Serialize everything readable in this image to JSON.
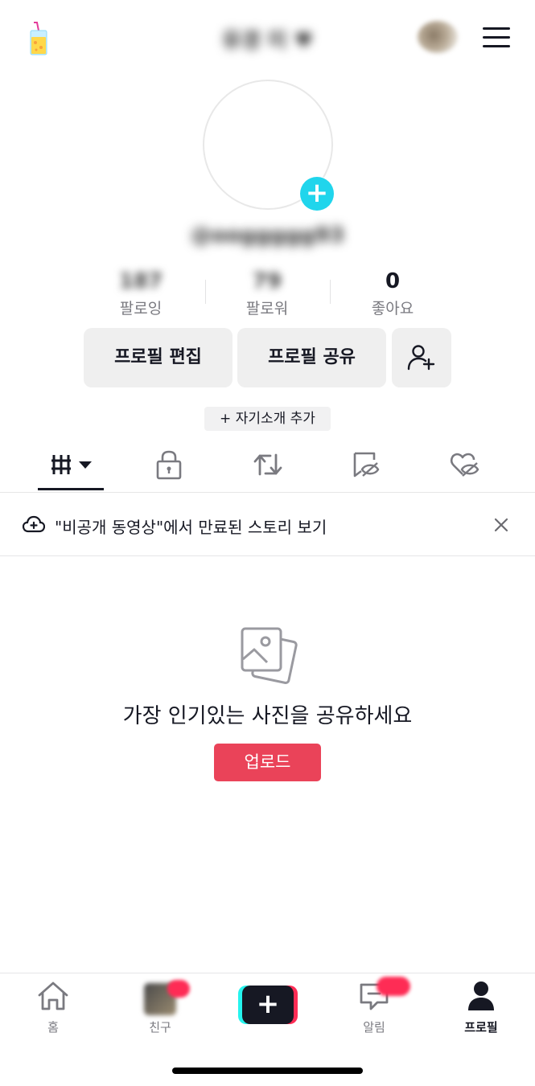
{
  "header": {
    "display_name": "유경 미 ♥",
    "menu_icon": "hamburger-menu-icon",
    "app_icon": "drink-icon"
  },
  "profile": {
    "handle": "@ooggggg93",
    "avatar_add_icon": "plus-icon"
  },
  "stats": [
    {
      "value": "187",
      "label": "팔로잉"
    },
    {
      "value": "79",
      "label": "팔로워"
    },
    {
      "value": "0",
      "label": "좋아요"
    }
  ],
  "buttons": {
    "edit_profile": "프로필 편집",
    "share_profile": "프로필 공유",
    "add_friend_icon": "add-user-icon"
  },
  "bio_add": "+ 자기소개 추가",
  "tabs": [
    {
      "icon": "grid-icon",
      "selected": true
    },
    {
      "icon": "lock-icon",
      "selected": false
    },
    {
      "icon": "repost-icon",
      "selected": false
    },
    {
      "icon": "hidden-bookmark-icon",
      "selected": false
    },
    {
      "icon": "hidden-heart-icon",
      "selected": false
    }
  ],
  "banner": {
    "text": "\"비공개 동영상\"에서 만료된 스토리 보기",
    "icon": "cloud-plus-icon",
    "close_icon": "close-icon"
  },
  "empty_state": {
    "icon": "photos-icon",
    "message": "가장 인기있는 사진을 공유하세요",
    "upload_label": "업로드"
  },
  "bottom_nav": [
    {
      "label": "홈",
      "icon": "home-icon"
    },
    {
      "label": "친구",
      "icon": "friend-thumbnail"
    },
    {
      "label": "",
      "icon": "create-plus-icon"
    },
    {
      "label": "알림",
      "icon": "inbox-icon"
    },
    {
      "label": "프로필",
      "icon": "profile-icon",
      "active": true
    }
  ],
  "colors": {
    "accent_cyan": "#20d5ec",
    "upload_red": "#ea4359",
    "badge_red": "#fe2c55",
    "text_dark": "#161823",
    "text_muted": "#7a7a80",
    "button_bg": "#efefef"
  }
}
